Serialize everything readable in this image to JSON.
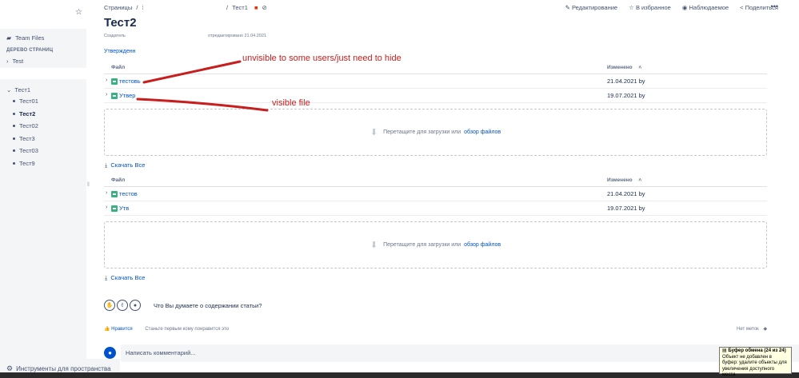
{
  "sidebar": {
    "team_files": "Team Files",
    "tree_header": "ДЕРЕВО СТРАНИЦ",
    "test_item": "Test",
    "root_item": "Тест1",
    "children": [
      "Тест01",
      "Тест2",
      "Тест02",
      "Тест3",
      "Тест03",
      "Тест9"
    ],
    "current": "Тест2",
    "tools": "Инструменты для пространства"
  },
  "topbar": {
    "crumb_pages": "Страницы",
    "crumb_sep": "/",
    "crumb_parent": "Тест1",
    "edit": "Редактирование",
    "favorite": "В избранное",
    "watch": "Наблюдаемое",
    "share": "Поделиться",
    "more": "•••"
  },
  "page": {
    "title": "Тест2",
    "creator_label": "Создатель",
    "edited": "отредактировано 21.04.2021",
    "section": "Утвержденн"
  },
  "tables": [
    {
      "col_file": "Файл",
      "col_changed": "Изменено",
      "rows": [
        {
          "name": "тестовь",
          "date": "21.04.2021 by"
        },
        {
          "name": "Утвер",
          "date": "19.07.2021 by"
        }
      ],
      "drop_text": "Перетащите для загрузки или",
      "drop_link": "обзор файлов",
      "download": "Скачать Все"
    },
    {
      "col_file": "Файл",
      "col_changed": "Изменено",
      "rows": [
        {
          "name": "тестов",
          "date": "21.04.2021 by"
        },
        {
          "name": "Утв",
          "date": "19.07.2021 by"
        }
      ],
      "drop_text": "Перетащите для загрузки или",
      "drop_link": "обзор файлов",
      "download": "Скачать Все"
    }
  ],
  "feedback": {
    "question": "Что Вы думаете о содержании статьи?",
    "like": "Нравится",
    "be_first": "Станьте первым кому понравится это",
    "no_labels": "Нет меток",
    "comment_placeholder": "Написать комментарий..."
  },
  "clipboard": {
    "title": "Буфер обмена (24 из 24)",
    "text": "Объект не добавлен в буфер: удалите объекты для увеличения доступного места"
  },
  "annotations": {
    "hidden_note": "unvisible to some users/just need to hide",
    "visible_note": "visible file",
    "color": "#c81e1e"
  }
}
